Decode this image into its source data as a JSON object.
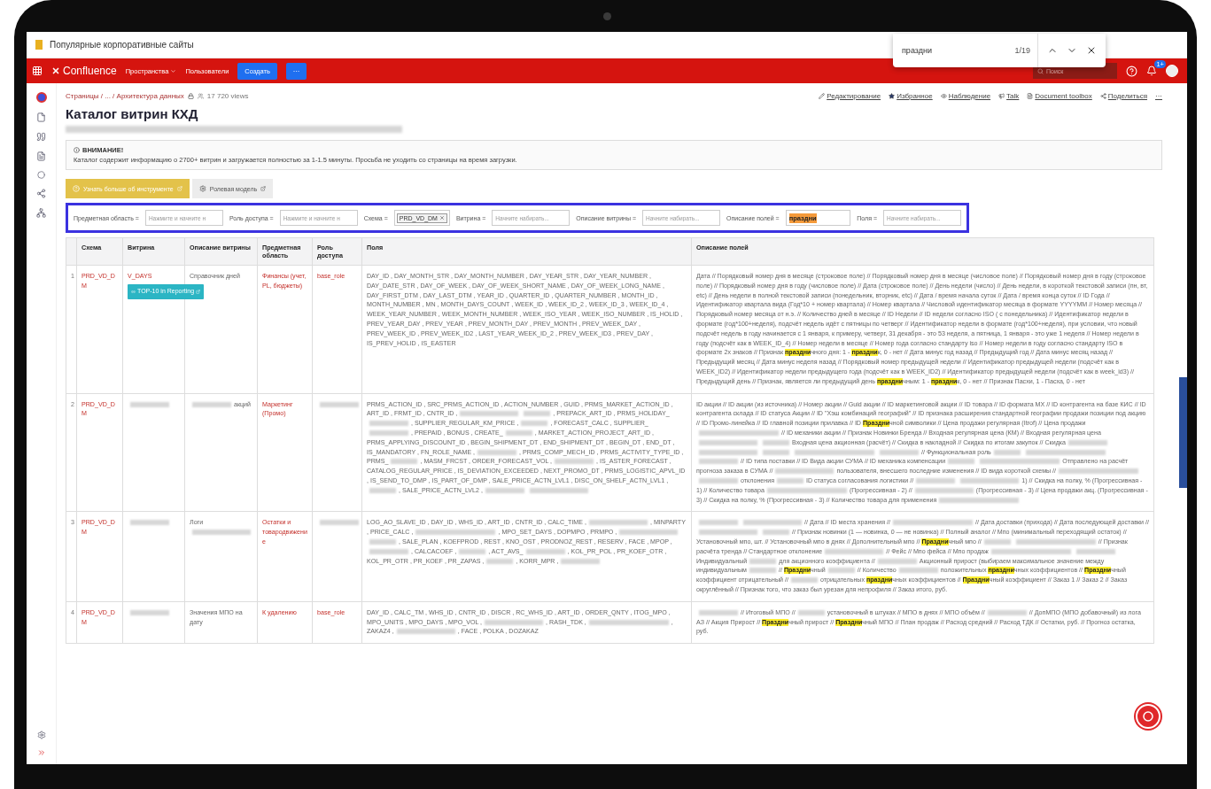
{
  "browser_tab": {
    "title": "Популярные корпоративные сайты"
  },
  "find_bar": {
    "query": "праздни",
    "count": "1/19"
  },
  "topnav": {
    "product": "Confluence",
    "menus": [
      {
        "label": "Пространства",
        "dropdown": true
      },
      {
        "label": "Пользователи",
        "dropdown": false
      }
    ],
    "create": "Создать",
    "more": "···",
    "search_placeholder": "Поиск",
    "badge": "1+"
  },
  "breadcrumb": {
    "path": "Страницы / ... / Архитектура данных",
    "views": "17 720 views"
  },
  "page_actions": [
    {
      "kind": "edit",
      "label": "Редактирование"
    },
    {
      "kind": "star",
      "label": "Избранное"
    },
    {
      "kind": "watch",
      "label": "Наблюдение"
    },
    {
      "kind": "talk",
      "label": "Talk"
    },
    {
      "kind": "toolbox",
      "label": "Document toolbox"
    },
    {
      "kind": "share",
      "label": "Поделиться"
    },
    {
      "kind": "more",
      "label": "···"
    }
  ],
  "title": "Каталог витрин КХД",
  "notice": {
    "heading": "ВНИМАНИЕ!",
    "text": "Каталог содержит информацию о 2700+ витрин и загружается полностью за 1-1.5 минуты. Просьба не уходить со страницы на время загрузки."
  },
  "buttons": [
    {
      "kind": "primary",
      "label": "Узнать больше об инструменте"
    },
    {
      "kind": "secondary",
      "label": "Ролевая модель"
    }
  ],
  "filters": [
    {
      "label": "Предметная область =",
      "placeholder": "Нажмите и начните н"
    },
    {
      "label": "Роль доступа =",
      "placeholder": "Нажмите и начните н"
    },
    {
      "label": "Схема =",
      "chips": [
        "PRD_VD_DM"
      ]
    },
    {
      "label": "Витрина =",
      "placeholder": "Начните набирать..."
    },
    {
      "label": "Описание витрины =",
      "placeholder": "Начните набирать..."
    },
    {
      "label": "Описание полей =",
      "value": "праздни"
    },
    {
      "label": "Поля =",
      "placeholder": "Начните набирать..."
    }
  ],
  "table": {
    "columns": [
      "Схема",
      "Витрина",
      "Описание витрины",
      "Предметная область",
      "Роль доступа",
      "Поля",
      "Описание полей"
    ],
    "rows": [
      {
        "number": "1",
        "schema": "PRD_VD_DM",
        "vitrina": [
          {
            "kind": "text",
            "text": "V_DAYS"
          }
        ],
        "tag": "TOP-10 in Reporting",
        "description": [
          {
            "kind": "text",
            "text": "Справочник дней"
          }
        ],
        "area": [
          {
            "kind": "text",
            "text": "Финансы (учет, PL, бюджеты)"
          }
        ],
        "role": [
          {
            "kind": "text",
            "text": "base_role"
          }
        ],
        "fields": [
          {
            "kind": "text",
            "text": "DAY_ID , DAY_MONTH_STR , DAY_MONTH_NUMBER , DAY_YEAR_STR , DAY_YEAR_NUMBER , DAY_DATE_STR , DAY_OF_WEEK , DAY_OF_WEEK_SHORT_NAME , DAY_OF_WEEK_LONG_NAME , DAY_FIRST_DTM , DAY_LAST_DTM , YEAR_ID , QUARTER_ID , QUARTER_NUMBER , MONTH_ID , MONTH_NUMBER , MN , MONTH_DAYS_COUNT , WEEK_ID , WEEK_ID_2 , WEEK_ID_3 , WEEK_ID_4 , WEEK_YEAR_NUMBER , WEEK_MONTH_NUMBER , WEEK_ISO_YEAR , WEEK_ISO_NUMBER , IS_HOLID , PREV_YEAR_DAY , PREV_YEAR , PREV_MONTH_DAY , PREV_MONTH , PREV_WEEK_DAY , PREV_WEEK_ID , PREV_WEEK_ID2 , LAST_YEAR_WEEK_ID_2 , PREV_WEEK_ID3 , PREV_DAY , IS_PREV_HOLID , IS_EASTER"
          }
        ],
        "field_descriptions": [
          {
            "kind": "text",
            "text": "Дата // Порядковый номер дня в месяце (строковое поле) // Порядковый номер дня в месяце (числовое поле) // Порядковый номер дня в году (строковое поле) // Порядковый номер дня в году (числовое поле) // Дата (строковое поле) // День недели (число) // День недели, в короткой текстовой записи (пн, вт, etc) // День недели в полной текстовой записи (понедельник, вторник, etc) // Дата / время начала суток // Дата / время конца суток // ID Года // Идентификатор квартала вида (Год*10 + номер квартала) // Номер квартала // Числовой идентификатор месяца в формате YYYYMM // Номер месяца // Порядковый номер месяца от н.э. // Количество дней в месяце // ID Недели // ID недели согласно ISO ( с понедельника) // Идентификатор недели в формате (год*100+неделя), подсчёт недель идёт с пятницы по четверг // Идентификатор недели в формате (год*100+неделя), при условии, что новый подсчёт недель в году начинается с 1 января, к примеру, четверг, 31 декабря - это 53 неделя, а пятница, 1 января - это уже 1 неделя // Номер недели в году (подсчёт как в WEEK_ID_4) // Номер недели в месяце // Номер года согласно стандарту iso // Номер недели в году согласно стандарту ISO в формате 2х знаков // Признак "
          },
          {
            "kind": "mark",
            "text": "праздни"
          },
          {
            "kind": "text",
            "text": "чного дня: 1 - "
          },
          {
            "kind": "mark",
            "text": "праздни"
          },
          {
            "kind": "text",
            "text": "к, 0 - нет // Дата минус год назад // Предыдущий год // Дата минус месяц назад // Предыдущий месяц // Дата минус неделя назад // Порядковый номер предыдущей недели // Идентификатор предыдущей недели (подсчёт как в WEEK_ID2) // Идентификатор недели предыдущего года (подсчёт как в WEEK_ID2) // Идентификатор предыдущей недели (подсчёт как в week_id3) // Предыдущий день // Признак, является ли предыдущий день "
          },
          {
            "kind": "mark",
            "text": "праздни"
          },
          {
            "kind": "text",
            "text": "чным: 1 - "
          },
          {
            "kind": "mark",
            "text": "праздни"
          },
          {
            "kind": "text",
            "text": "к, 0 - нет // Признак Пасхи, 1 - Пасха, 0 - нет"
          }
        ]
      },
      {
        "number": "2",
        "schema": "PRD_VD_DM",
        "vitrina": [
          {
            "kind": "blur"
          }
        ],
        "description": [
          {
            "kind": "blur"
          },
          {
            "kind": "text",
            "text": "акций"
          }
        ],
        "area": [
          {
            "kind": "text",
            "text": "Маркетинг (Промо)"
          }
        ],
        "role": [
          {
            "kind": "blur"
          }
        ],
        "fields": [
          {
            "kind": "text",
            "text": "PRMS_ACTION_ID , SRC_PRMS_ACTION_ID , ACTION_NUMBER , GUID , PRMS_MARKET_ACTION_ID , ART_ID , FRMT_ID , CNTR_ID ,"
          },
          {
            "kind": "blur"
          },
          {
            "kind": "blur"
          },
          {
            "kind": "text",
            "text": ", PREPACK_ART_ID , PRMS_HOLIDAY_"
          },
          {
            "kind": "blur"
          },
          {
            "kind": "text",
            "text": ", SUPPLIER_REGULAR_KM_PRICE ,"
          },
          {
            "kind": "blur"
          },
          {
            "kind": "text",
            "text": ", FORECAST_CALC , SUPPLIER_"
          },
          {
            "kind": "blur"
          },
          {
            "kind": "text",
            "text": ", PREPAID , BONUS , CREATE_"
          },
          {
            "kind": "blur"
          },
          {
            "kind": "text",
            "text": ", MARKET_ACTION_PROJECT_ART_ID , PRMS_APPLYING_DISCOUNT_ID , BEGIN_SHIPMENT_DT , END_SHIPMENT_DT , BEGIN_DT , END_DT , IS_MANDATORY , FN_ROLE_NAME ,"
          },
          {
            "kind": "blur"
          },
          {
            "kind": "text",
            "text": ", PRMS_COMP_MECH_ID , PRMS_ACTIVITY_TYPE_ID , PRMS_"
          },
          {
            "kind": "blur"
          },
          {
            "kind": "text",
            "text": ", MASM_FRCST , ORDER_FORECAST_VOL ,"
          },
          {
            "kind": "blur"
          },
          {
            "kind": "text",
            "text": ", IS_ASTER_FORECAST , CATALOG_REGULAR_PRICE , IS_DEVIATION_EXCEEDED , NEXT_PROMO_DT , PRMS_LOGISTIC_APVL_ID , IS_SEND_TO_DMP , IS_PART_OF_DMP , SALE_PRICE_ACTN_LVL1 , DISC_ON_SHELF_ACTN_LVL1 ,"
          },
          {
            "kind": "blur"
          },
          {
            "kind": "text",
            "text": ", SALE_PRICE_ACTN_LVL2 ,"
          },
          {
            "kind": "blur"
          },
          {
            "kind": "blur"
          }
        ],
        "field_descriptions": [
          {
            "kind": "text",
            "text": "ID акции // ID акции (из источника) // Номер акции // Guid акции // ID маркетинговой акции // ID товара // ID формата МХ // ID контрагента на базе КИС // ID контрагента склада // ID статуса Акции // ID \"Хэш комбинаций географий\" // ID признака расширения стандартной географии продажи позиции под акцию // ID Промо-линейка // ID главной позиции прилавка // ID "
          },
          {
            "kind": "mark",
            "text": "Праздни"
          },
          {
            "kind": "text",
            "text": "чной символики // Цена продажи регулярная (Itrof) // Цена продажи"
          },
          {
            "kind": "blur"
          },
          {
            "kind": "text",
            "text": "// ID механики акции // Признак Новинки Бренда // Входная регулярная цена (КМ) // Входная регулярная цена"
          },
          {
            "kind": "blur"
          },
          {
            "kind": "blur"
          },
          {
            "kind": "text",
            "text": "Входная цена акционная (расчёт) // Скидка в накладной // Скидка по итогам закупок // Скидка"
          },
          {
            "kind": "blur"
          },
          {
            "kind": "blur"
          },
          {
            "kind": "blur"
          },
          {
            "kind": "blur"
          },
          {
            "kind": "blur"
          },
          {
            "kind": "text",
            "text": "// Функциональная роль"
          },
          {
            "kind": "blur"
          },
          {
            "kind": "blur"
          },
          {
            "kind": "blur"
          },
          {
            "kind": "text",
            "text": "// ID типа поставки // ID Вида акции СУМА // ID механика компенсации"
          },
          {
            "kind": "blur"
          },
          {
            "kind": "blur"
          },
          {
            "kind": "text",
            "text": "Отправлено на расчёт прогноза заказа в СУМА //"
          },
          {
            "kind": "blur"
          },
          {
            "kind": "text",
            "text": "пользователя, внесшего последние изменения // ID вида короткой схемы //"
          },
          {
            "kind": "blur"
          },
          {
            "kind": "blur"
          },
          {
            "kind": "text",
            "text": "отклонения"
          },
          {
            "kind": "blur"
          },
          {
            "kind": "text",
            "text": "ID статуса согласования логистики //"
          },
          {
            "kind": "blur"
          },
          {
            "kind": "blur"
          },
          {
            "kind": "text",
            "text": "1) // Скидка на полку, % (Прогрессивная - 1) // Количество товара"
          },
          {
            "kind": "blur"
          },
          {
            "kind": "text",
            "text": "(Прогрессивная - 2) //"
          },
          {
            "kind": "blur"
          },
          {
            "kind": "text",
            "text": "(Прогрессивная - 3) // Цена продажи акц. (Прогрессивная - 3) // Скидка на полку, % (Прогрессивная - 3) // Количество товара для применения"
          },
          {
            "kind": "blur"
          }
        ]
      },
      {
        "number": "3",
        "schema": "PRD_VD_DM",
        "vitrina": [
          {
            "kind": "blur"
          }
        ],
        "description": [
          {
            "kind": "text",
            "text": "Логи"
          },
          {
            "kind": "blur"
          }
        ],
        "area": [
          {
            "kind": "text",
            "text": "Остатки и товародвижение"
          }
        ],
        "role": [
          {
            "kind": "blur"
          }
        ],
        "fields": [
          {
            "kind": "text",
            "text": "LOG_AO_SLAVE_ID , DAY_ID , WHS_ID , ART_ID , CNTR_ID , CALC_TIME ,"
          },
          {
            "kind": "blur"
          },
          {
            "kind": "text",
            "text": ", MINPARTY , PRICE_CALC ,"
          },
          {
            "kind": "blur"
          },
          {
            "kind": "text",
            "text": ", MPO_SET_DAYS , DOPMPO , PRMPO ,"
          },
          {
            "kind": "blur"
          },
          {
            "kind": "blur"
          },
          {
            "kind": "text",
            "text": ", SALE_PLAN , KOEFPROD , REST , KNO_OST , PRODNOZ_REST , RESERV , FACE , MPOP ,"
          },
          {
            "kind": "blur"
          },
          {
            "kind": "text",
            "text": ", CALCACOEF ,"
          },
          {
            "kind": "blur"
          },
          {
            "kind": "text",
            "text": ", ACT_AVS_"
          },
          {
            "kind": "blur"
          },
          {
            "kind": "text",
            "text": ", KOL_PR_POL , PR_KOEF_OTR , KOL_PR_OTR , PR_KOEF , PR_ZAPAS ,"
          },
          {
            "kind": "blur"
          },
          {
            "kind": "text",
            "text": ", KORR_MPR ,"
          },
          {
            "kind": "blur"
          }
        ],
        "field_descriptions": [
          {
            "kind": "blur"
          },
          {
            "kind": "blur"
          },
          {
            "kind": "text",
            "text": "// Дата // ID места хранения //"
          },
          {
            "kind": "blur"
          },
          {
            "kind": "text",
            "text": "// Дата доставки (прихода) // Дата последующей доставки //"
          },
          {
            "kind": "blur"
          },
          {
            "kind": "blur"
          },
          {
            "kind": "text",
            "text": "// Признак новинки (1 — новинка, 0 — не новинка) // Полный аналог // Мпо (минимальный переходящий остаток) // Установочный мпо, шт. // Установочный мпо в днях // Дополнительный мпо // "
          },
          {
            "kind": "mark",
            "text": "Праздни"
          },
          {
            "kind": "text",
            "text": "чный мпо //"
          },
          {
            "kind": "blur"
          },
          {
            "kind": "blur"
          },
          {
            "kind": "text",
            "text": "// Признак расчёта тренда // Стандартное отклонение"
          },
          {
            "kind": "blur"
          },
          {
            "kind": "text",
            "text": "// Фейс // Мпо фейса // Мпо продаж"
          },
          {
            "kind": "blur"
          },
          {
            "kind": "blur"
          },
          {
            "kind": "text",
            "text": "Индивидуальный"
          },
          {
            "kind": "blur"
          },
          {
            "kind": "text",
            "text": "для акционного коэффициента //"
          },
          {
            "kind": "blur"
          },
          {
            "kind": "text",
            "text": "Акционный прирост (выбираем максимальное значение между индивидуальным"
          },
          {
            "kind": "blur"
          },
          {
            "kind": "text",
            "text": "// "
          },
          {
            "kind": "mark",
            "text": "Праздни"
          },
          {
            "kind": "text",
            "text": "чный"
          },
          {
            "kind": "blur"
          },
          {
            "kind": "text",
            "text": "// Количество"
          },
          {
            "kind": "blur"
          },
          {
            "kind": "text",
            "text": "положительных "
          },
          {
            "kind": "mark",
            "text": "праздни"
          },
          {
            "kind": "text",
            "text": "чных коэффициентов // "
          },
          {
            "kind": "mark",
            "text": "Праздни"
          },
          {
            "kind": "text",
            "text": "чный коэффициент отрицательный //"
          },
          {
            "kind": "blur"
          },
          {
            "kind": "text",
            "text": "отрицательных "
          },
          {
            "kind": "mark",
            "text": "праздни"
          },
          {
            "kind": "text",
            "text": "чных коэффициентов // "
          },
          {
            "kind": "mark",
            "text": "Праздни"
          },
          {
            "kind": "text",
            "text": "чный коэффициент // Заказ 1 // Заказ 2 // Заказ округлённый // Признак того, что заказ был урезан для непрофиля // Заказ итого, руб."
          }
        ]
      },
      {
        "number": "4",
        "schema": "PRD_VD_DM",
        "vitrina": [
          {
            "kind": "blur"
          }
        ],
        "description": [
          {
            "kind": "text",
            "text": "Значения МПО на дату"
          }
        ],
        "area": [
          {
            "kind": "text",
            "text": "К удалению"
          }
        ],
        "role": [
          {
            "kind": "text",
            "text": "base_role"
          }
        ],
        "fields": [
          {
            "kind": "text",
            "text": "DAY_ID , CALC_TM , WHS_ID , CNTR_ID , DISCR , RC_WHS_ID , ART_ID , ORDER_QNTY , ITOG_MPO , MPO_UNITS , MPO_DAYS , MPO_VOL ,"
          },
          {
            "kind": "blur"
          },
          {
            "kind": "text",
            "text": ", RASH_TDK ,"
          },
          {
            "kind": "blur"
          },
          {
            "kind": "text",
            "text": ", ZAKAZ4 ,"
          },
          {
            "kind": "blur"
          },
          {
            "kind": "text",
            "text": ", FACE , POLKA , DOZAKAZ"
          }
        ],
        "field_descriptions": [
          {
            "kind": "blur"
          },
          {
            "kind": "text",
            "text": "// Итоговый МПО //"
          },
          {
            "kind": "blur"
          },
          {
            "kind": "text",
            "text": "установочный в штуках // МПО в днях // МПО объём //"
          },
          {
            "kind": "blur"
          },
          {
            "kind": "text",
            "text": "// ДопМПО (МПО добавочный) из лога АЗ // Акция Прирост // "
          },
          {
            "kind": "mark",
            "text": "Праздни"
          },
          {
            "kind": "text",
            "text": "чный прирост // "
          },
          {
            "kind": "mark",
            "text": "Праздни"
          },
          {
            "kind": "text",
            "text": "чный МПО // План продаж // Расход средний // Расход ТДК // Остатки, руб. // Прогноз остатка, руб."
          }
        ]
      }
    ]
  }
}
